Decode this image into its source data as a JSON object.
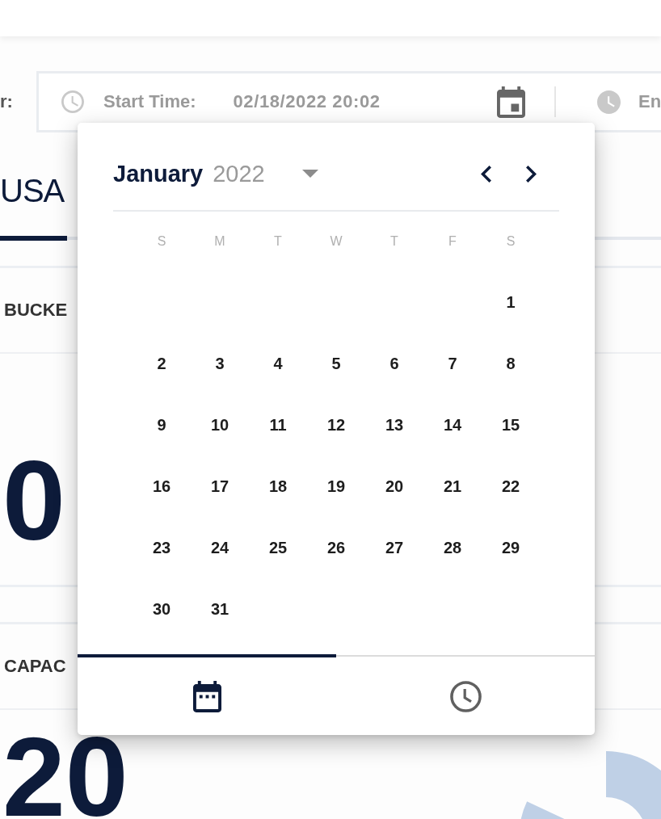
{
  "filter_bar": {
    "label": "r:",
    "start": {
      "label": "Start Time:",
      "value": "02/18/2022 20:02"
    },
    "end": {
      "label": "En"
    }
  },
  "tabs": [
    {
      "label": "USA",
      "selected": true
    }
  ],
  "cards": [
    {
      "kind": "plain",
      "title": "BUCKE",
      "value": "0"
    },
    {
      "kind": "donut",
      "title": "CAPAC",
      "value": "20"
    }
  ],
  "date_picker": {
    "month": "January",
    "year": "2022",
    "weekdays": [
      "S",
      "M",
      "T",
      "W",
      "T",
      "F",
      "S"
    ],
    "weeks": [
      [
        "1"
      ],
      [
        "2",
        "3",
        "4",
        "5",
        "6",
        "7",
        "8"
      ],
      [
        "9",
        "10",
        "11",
        "12",
        "13",
        "14",
        "15"
      ],
      [
        "16",
        "17",
        "18",
        "19",
        "20",
        "21",
        "22"
      ],
      [
        "23",
        "24",
        "25",
        "26",
        "27",
        "28",
        "29"
      ],
      [
        "30",
        "31"
      ]
    ],
    "footer_tabs": [
      {
        "kind": "date",
        "selected": true
      },
      {
        "kind": "time",
        "selected": false
      }
    ]
  }
}
